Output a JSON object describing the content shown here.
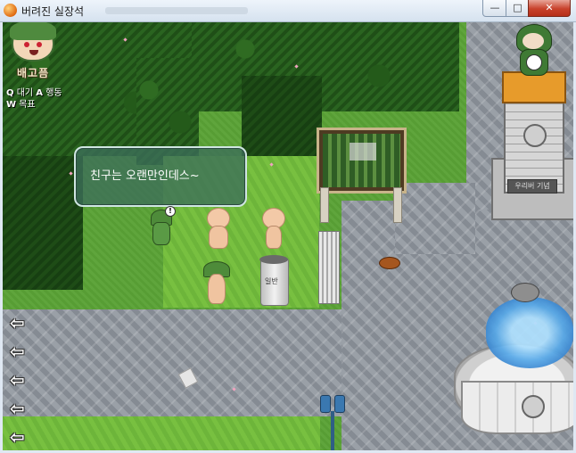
{
  "window": {
    "title": "버려진 실장석",
    "buttons": {
      "minimize": "—",
      "maximize": "□",
      "close": "✕"
    }
  },
  "hud": {
    "status": "배고픔",
    "hints": [
      {
        "key": "Q",
        "label": "대기"
      },
      {
        "key": "A",
        "label": "행동"
      },
      {
        "key": "W",
        "label": "목표"
      }
    ]
  },
  "dialogue": {
    "text": "친구는 오랜만인데스~"
  },
  "trash_can": {
    "label": "일반"
  },
  "monument": {
    "plaque": "우리버 기념"
  },
  "icons": {
    "app": "orange-orb-icon",
    "exit_arrows": [
      "left-arrow-icon",
      "left-arrow-icon",
      "left-arrow-icon",
      "left-arrow-icon",
      "left-arrow-icon"
    ]
  },
  "colors": {
    "grass": "#5aa236",
    "forest": "#1f4f17",
    "path": "#8f959c",
    "bubble": "#3c6e5a"
  }
}
